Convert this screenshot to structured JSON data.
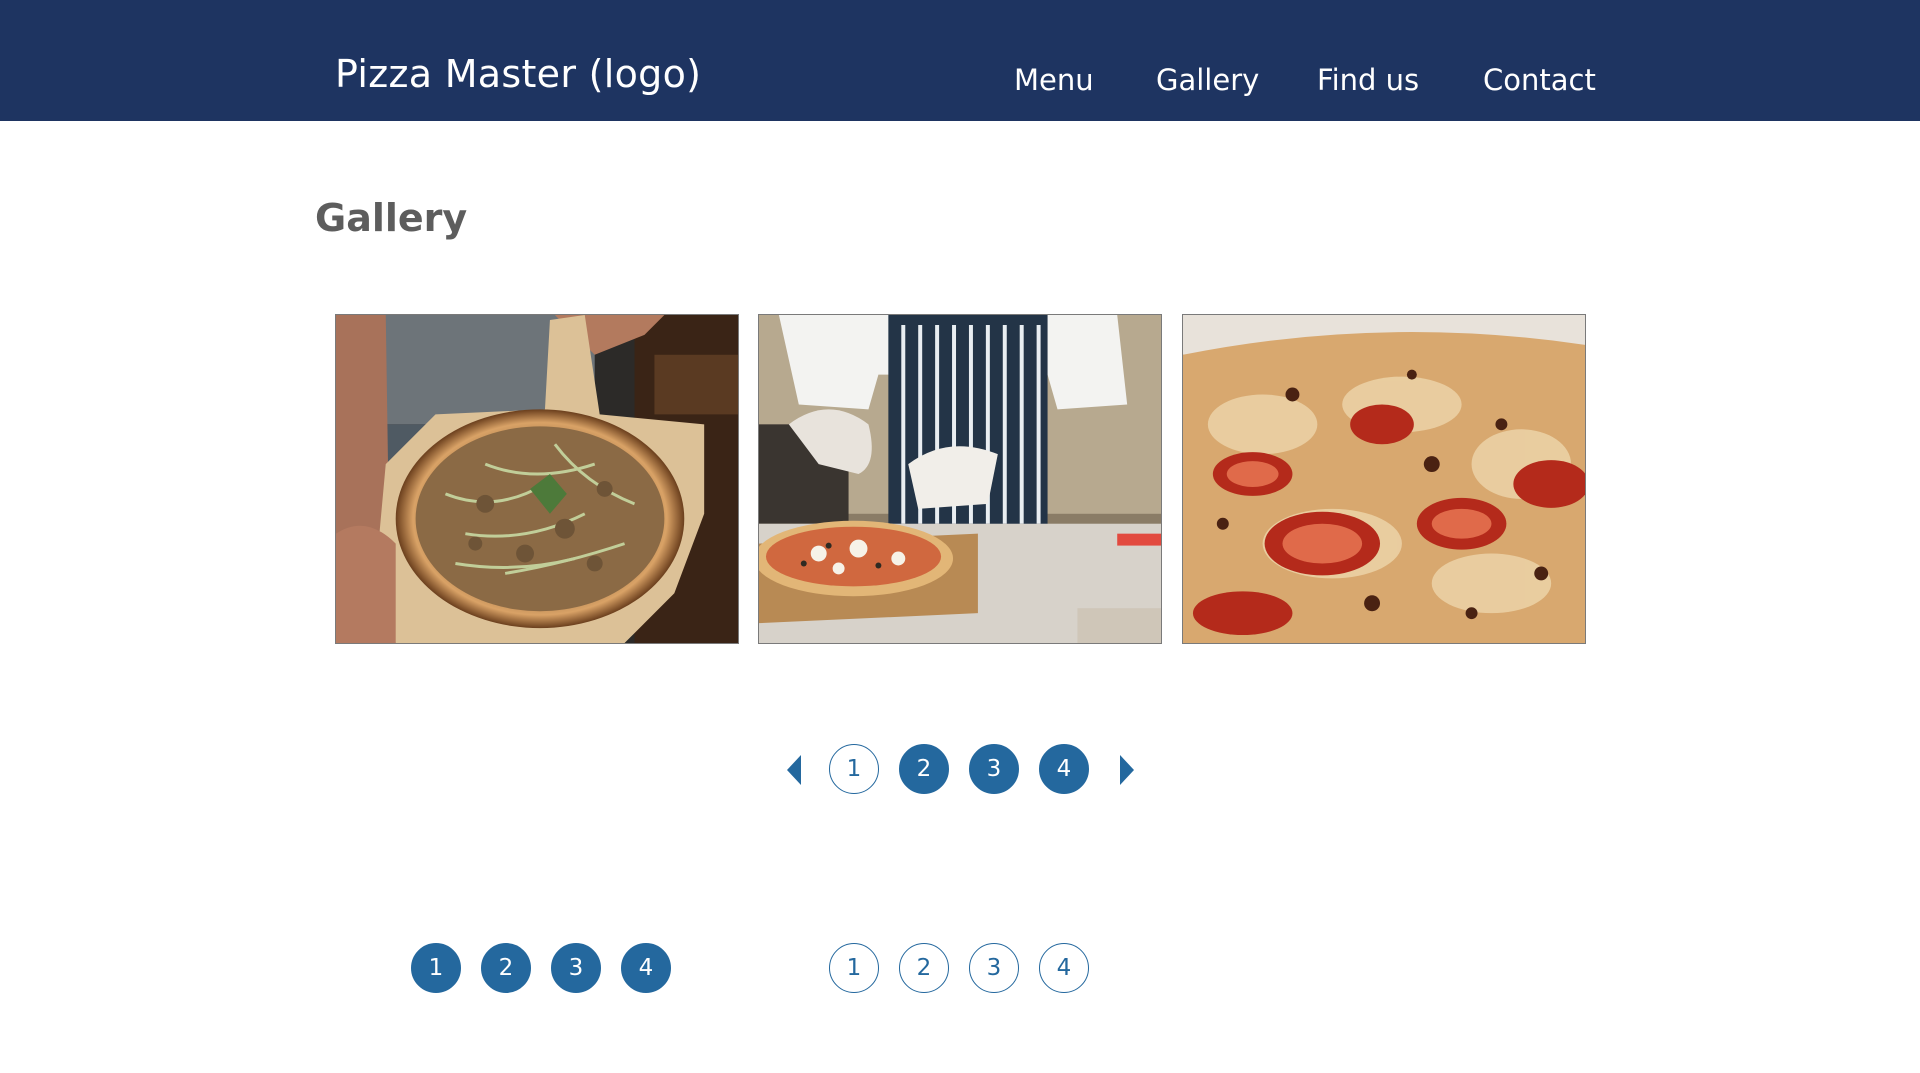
{
  "header": {
    "logo_text": "Pizza Master (logo)",
    "nav": [
      {
        "label": "Menu"
      },
      {
        "label": "Gallery"
      },
      {
        "label": "Find us"
      },
      {
        "label": "Contact"
      }
    ]
  },
  "main": {
    "title": "Gallery",
    "photos": [
      {
        "subject": "pizza-on-wooden-peel"
      },
      {
        "subject": "chef-topping-pizza"
      },
      {
        "subject": "pizza-closeup"
      }
    ],
    "carousel_pagination": {
      "prev_icon": "caret-left-icon",
      "next_icon": "caret-right-icon",
      "pages": [
        "1",
        "2",
        "3",
        "4"
      ],
      "outlined_page": "1"
    },
    "pagination_filled": [
      "1",
      "2",
      "3",
      "4"
    ],
    "pagination_outlined": [
      "1",
      "2",
      "3",
      "4"
    ]
  },
  "colors": {
    "header_bg": "#1e3461",
    "accent": "#24689e",
    "title_text": "#5d5d5d"
  }
}
